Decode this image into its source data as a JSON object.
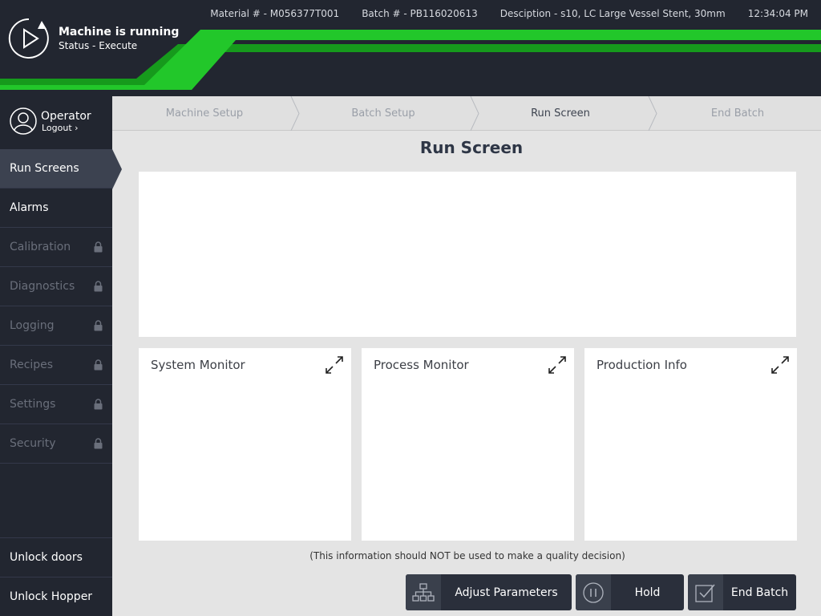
{
  "header": {
    "status_title": "Machine is running",
    "status_sub": "Status - Execute",
    "material": "Material # - M056377T001",
    "batch": "Batch # - PB116020613",
    "description": "Desciption - s10, LC Large Vessel Stent, 30mm",
    "time": "12:34:04 PM",
    "accent_color": "#22c72a",
    "accent_dark": "#169a1c"
  },
  "operator": {
    "name": "Operator",
    "logout": "Logout"
  },
  "nav": {
    "run_screens": "Run Screens",
    "alarms": "Alarms",
    "calibration": "Calibration",
    "diagnostics": "Diagnostics",
    "logging": "Logging",
    "recipes": "Recipes",
    "settings": "Settings",
    "security": "Security",
    "unlock_doors": "Unlock doors",
    "unlock_hopper": "Unlock Hopper"
  },
  "breadcrumbs": {
    "machine_setup": "Machine Setup",
    "batch_setup": "Batch Setup",
    "run_screen": "Run Screen",
    "end_batch": "End Batch"
  },
  "main": {
    "title": "Run Screen",
    "cards": {
      "system_monitor": "System Monitor",
      "process_monitor": "Process Monitor",
      "production_info": "Production Info"
    },
    "disclaimer": "(This information should NOT be used to make a quality decision)"
  },
  "actions": {
    "adjust": "Adjust Parameters",
    "hold": "Hold",
    "end_batch": "End Batch"
  }
}
